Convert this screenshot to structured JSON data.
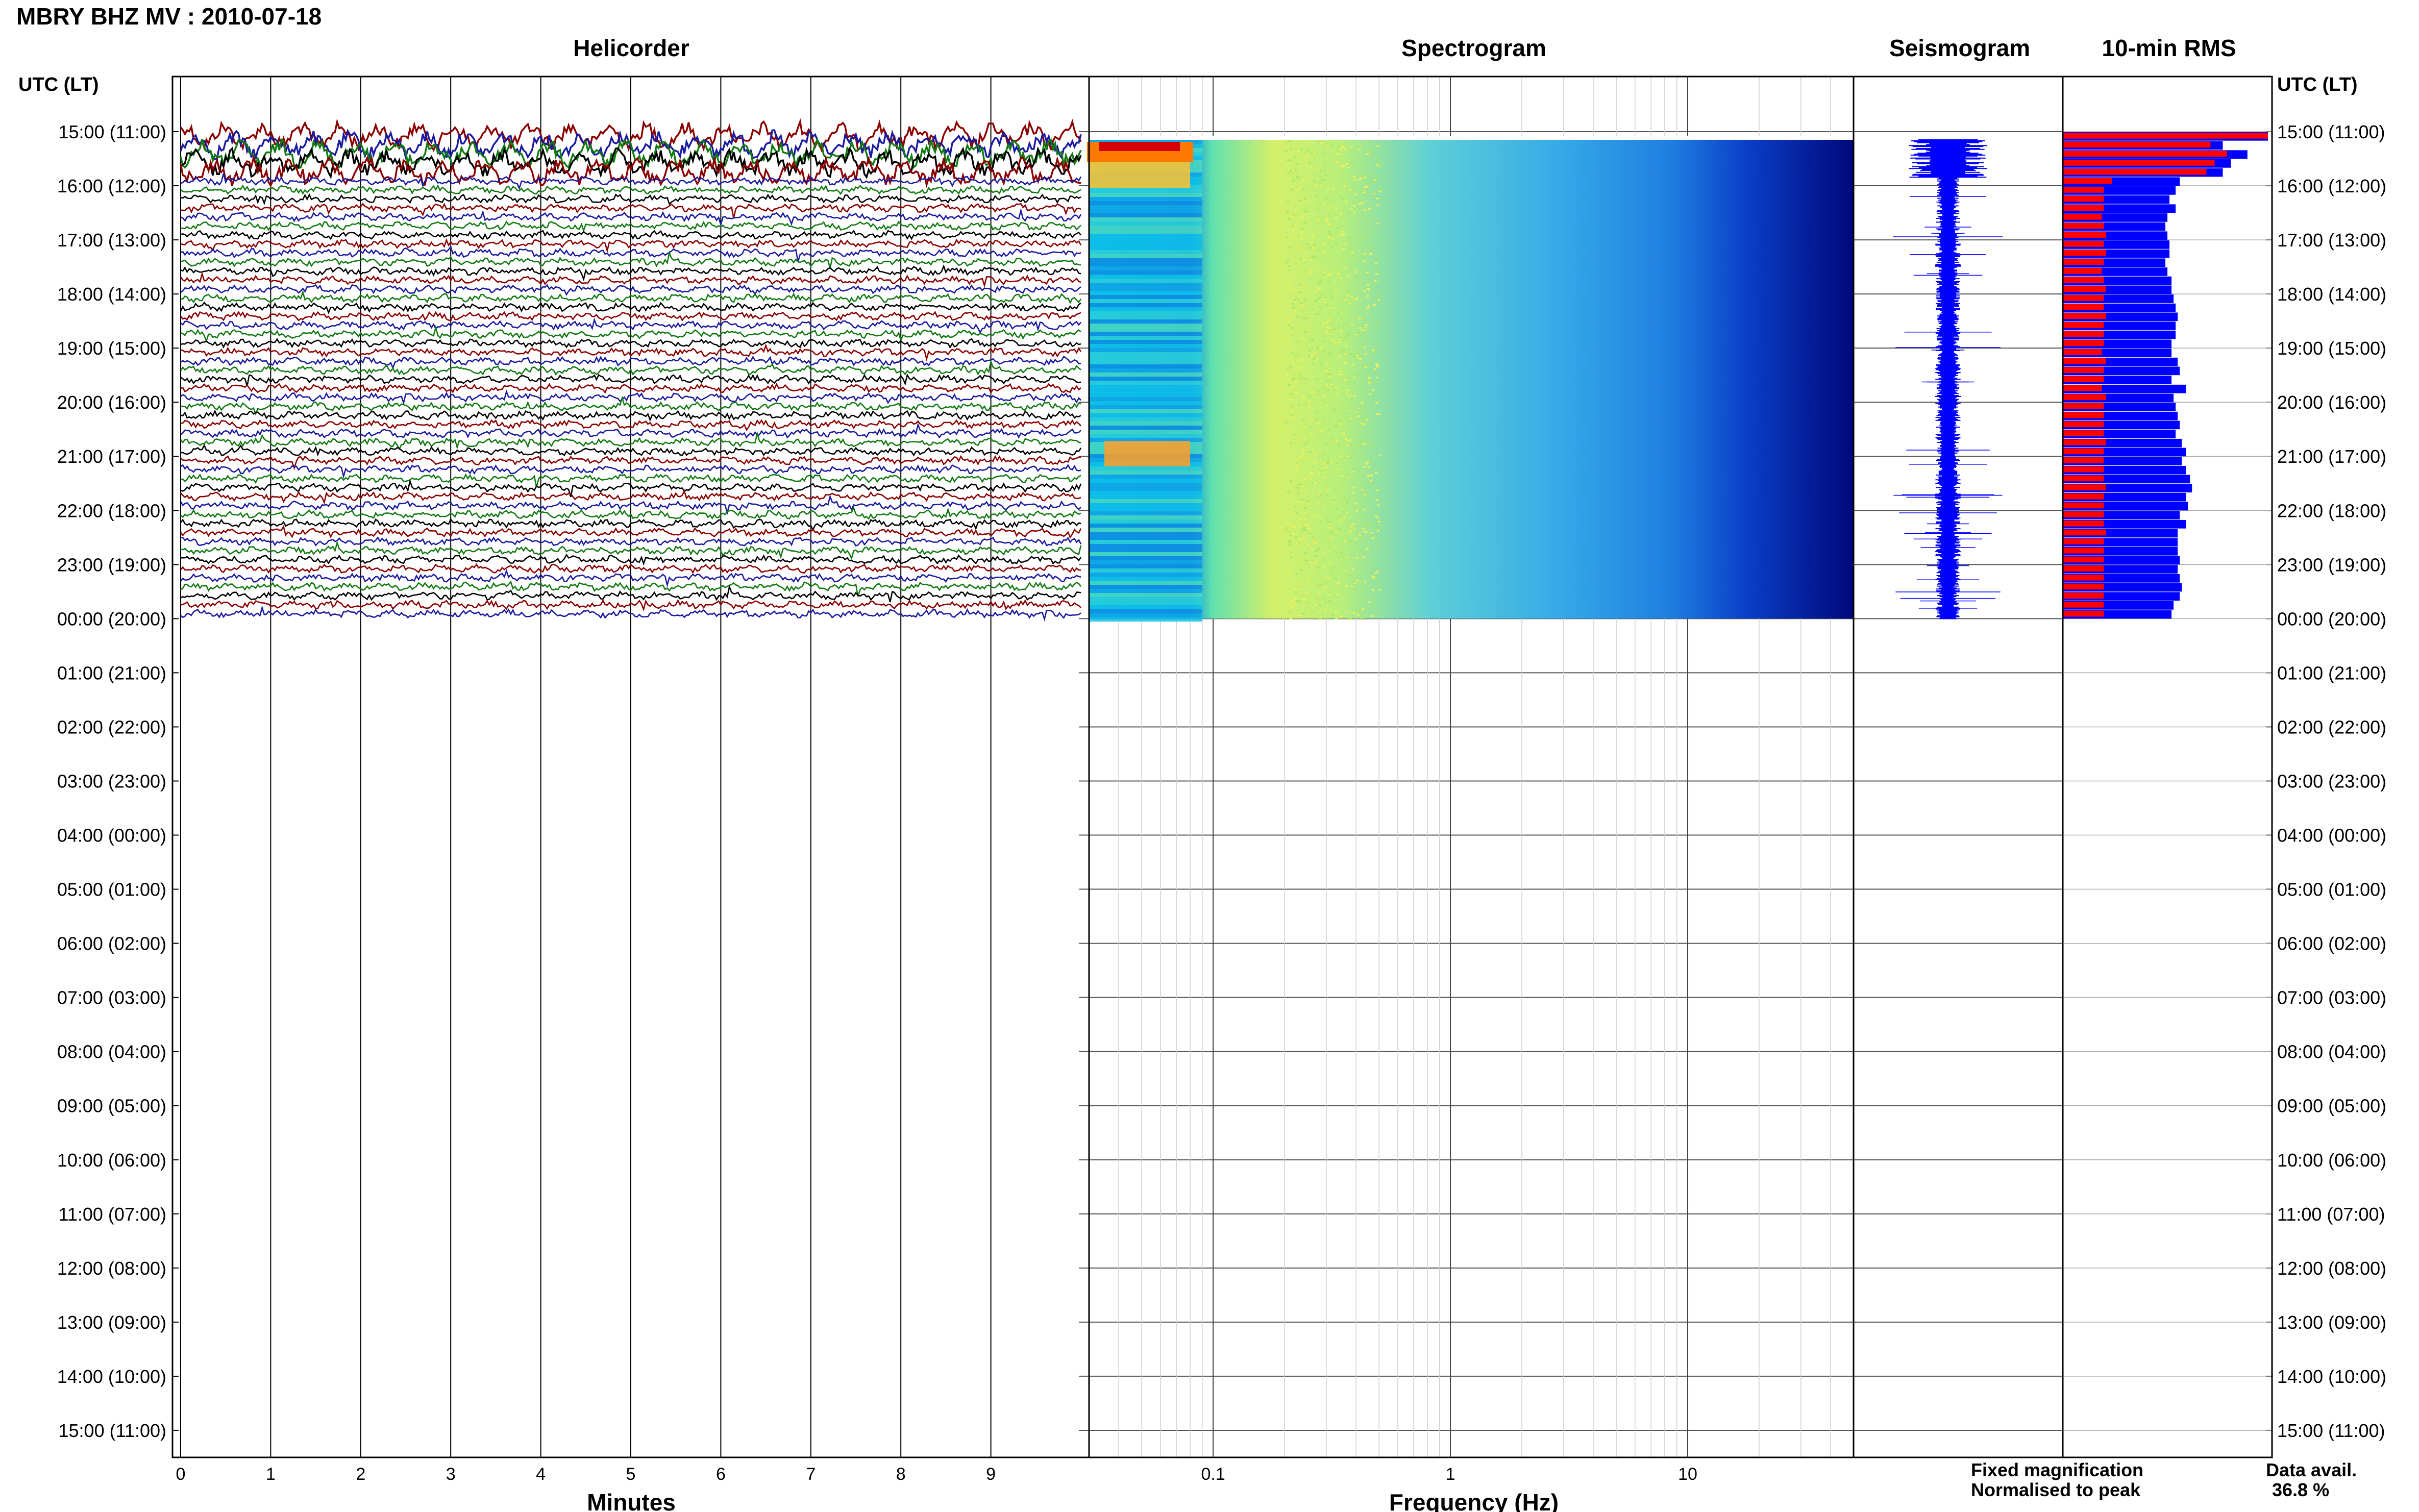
{
  "header": {
    "title": "MBRY BHZ MV : 2010-07-18"
  },
  "panels": {
    "helicorder": "Helicorder",
    "spectrogram": "Spectrogram",
    "seismogram": "Seismogram",
    "rms": "10-min RMS"
  },
  "axis": {
    "left_header": "UTC (LT)",
    "right_header": "UTC (LT)",
    "helicorder_xlabel": "Minutes",
    "spectrogram_xlabel": "Frequency (Hz)"
  },
  "footer": {
    "legend_fixed": "Fixed magnification",
    "legend_normalised": "Normalised to peak",
    "data_avail_label": "Data avail.",
    "data_avail_value": "36.8 %"
  },
  "colors": {
    "trace_cycle": [
      "#8b0000",
      "#1a1aa0",
      "#127a12",
      "#000000"
    ],
    "rms_fixed": "#0000ff",
    "rms_normalised": "#ff0000",
    "seismogram": "#0000ff",
    "legend_fixed": "#0000ff",
    "legend_normalised": "#ff0000"
  },
  "chart_data": {
    "type": "heatmap",
    "time_labels": [
      "15:00 (11:00)",
      "16:00 (12:00)",
      "17:00 (13:00)",
      "18:00 (14:00)",
      "19:00 (15:00)",
      "20:00 (16:00)",
      "21:00 (17:00)",
      "22:00 (18:00)",
      "23:00 (19:00)",
      "00:00 (20:00)",
      "01:00 (21:00)",
      "02:00 (22:00)",
      "03:00 (23:00)",
      "04:00 (00:00)",
      "05:00 (01:00)",
      "06:00 (02:00)",
      "07:00 (03:00)",
      "08:00 (04:00)",
      "09:00 (05:00)",
      "10:00 (06:00)",
      "11:00 (07:00)",
      "12:00 (08:00)",
      "13:00 (09:00)",
      "14:00 (10:00)",
      "15:00 (11:00)"
    ],
    "helicorder": {
      "xlabel": "Minutes",
      "xlim": [
        0,
        10
      ],
      "ticks": [
        "0",
        "1",
        "2",
        "3",
        "4",
        "5",
        "6",
        "7",
        "8",
        "9"
      ],
      "minutes_per_row": 10,
      "rows_with_data": 54,
      "data_hours": 9
    },
    "spectrogram": {
      "xlabel": "Frequency (Hz)",
      "scale": "log",
      "xlim": [
        0.03,
        50
      ],
      "ticks": [
        0.1,
        1,
        10
      ],
      "tick_labels": [
        "0.1",
        "1",
        "10"
      ],
      "low_freq_high_energy_band_hz": [
        0.03,
        0.08
      ],
      "microseism_peak_hz": [
        0.2,
        0.5
      ],
      "data_hours": 9
    },
    "rms": {
      "unit": "normalised",
      "fixed_magnification": [
        1.0,
        0.78,
        0.9,
        0.82,
        0.78,
        0.57,
        0.55,
        0.52,
        0.55,
        0.51,
        0.5,
        0.51,
        0.52,
        0.52,
        0.5,
        0.51,
        0.53,
        0.53,
        0.54,
        0.55,
        0.56,
        0.55,
        0.55,
        0.53,
        0.53,
        0.56,
        0.57,
        0.53,
        0.6,
        0.54,
        0.55,
        0.56,
        0.57,
        0.55,
        0.58,
        0.6,
        0.58,
        0.6,
        0.62,
        0.63,
        0.6,
        0.61,
        0.57,
        0.6,
        0.56,
        0.56,
        0.56,
        0.57,
        0.56,
        0.57,
        0.58,
        0.57,
        0.54,
        0.53
      ],
      "normalised_to_peak": [
        1.0,
        0.72,
        0.8,
        0.74,
        0.7,
        0.24,
        0.2,
        0.2,
        0.2,
        0.19,
        0.2,
        0.21,
        0.2,
        0.21,
        0.2,
        0.19,
        0.2,
        0.21,
        0.2,
        0.2,
        0.21,
        0.2,
        0.2,
        0.2,
        0.19,
        0.21,
        0.2,
        0.2,
        0.19,
        0.21,
        0.2,
        0.2,
        0.2,
        0.2,
        0.21,
        0.2,
        0.2,
        0.2,
        0.2,
        0.21,
        0.2,
        0.2,
        0.2,
        0.2,
        0.21,
        0.2,
        0.2,
        0.2,
        0.2,
        0.2,
        0.2,
        0.2,
        0.2,
        0.2
      ]
    }
  }
}
